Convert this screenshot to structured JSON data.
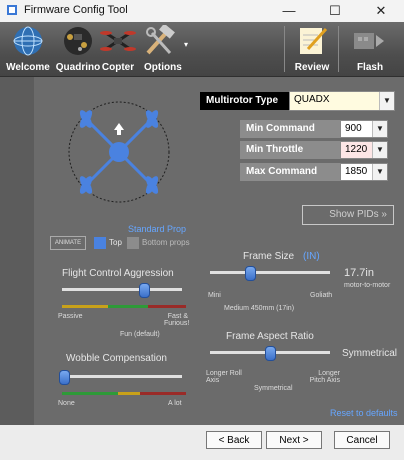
{
  "window": {
    "title": "Firmware Config Tool",
    "minimize": "—",
    "maximize": "☐",
    "close": "✕"
  },
  "toolbar": {
    "items": [
      {
        "label": "Welcome",
        "icon": "globe-icon"
      },
      {
        "label": "Quadrino",
        "icon": "circuit-board-icon"
      },
      {
        "label": "Copter",
        "icon": "quadcopter-icon"
      },
      {
        "label": "Options",
        "icon": "tools-icon"
      },
      {
        "label": "Review",
        "icon": "notepad-pencil-icon"
      },
      {
        "label": "Flash",
        "icon": "chip-flash-icon"
      }
    ],
    "options_arrow": "▾"
  },
  "multirotor": {
    "type_label": "Multirotor Type",
    "type_value": "QUADX"
  },
  "commands": {
    "min_command_label": "Min Command",
    "min_command_value": "900",
    "min_throttle_label": "Min Throttle",
    "min_throttle_value": "1220",
    "max_command_label": "Max Command",
    "max_command_value": "1850"
  },
  "show_pids_label": "Show PIDs »",
  "props": {
    "standard_prop": "Standard Prop",
    "animate_label": "ANIMATE",
    "top_label": "Top",
    "bottom_label": "Bottom props"
  },
  "frame_size": {
    "title": "Frame Size",
    "unit": "(IN)",
    "value": "17.7in",
    "value_sub": "motor-to-motor",
    "min_label": "Mini",
    "max_label": "Goliath",
    "medium_label": "Medium 450mm (17in)",
    "level": 0.33
  },
  "aggression": {
    "title": "Flight Control Aggression",
    "left_label": "Passive",
    "center_label": "Fun (default)",
    "right_label": "Fast & Furious!",
    "level": 0.68
  },
  "aspect": {
    "title": "Frame Aspect Ratio",
    "value": "Symmetrical",
    "left_label": "Longer Roll Axis",
    "center_label": "Symmetrical",
    "right_label": "Longer Pitch Axis",
    "level": 0.5
  },
  "wobble": {
    "title": "Wobble Compensation",
    "left_label": "None",
    "right_label": "A lot",
    "level": 0.02
  },
  "reset_label": "Reset to defaults",
  "nav": {
    "back": "< Back",
    "next": "Next >",
    "cancel": "Cancel"
  },
  "colors": {
    "accent_blue": "#4a82e0",
    "panel_grey": "#6b6b6b",
    "min_throttle_highlight": "#fde6e6"
  }
}
